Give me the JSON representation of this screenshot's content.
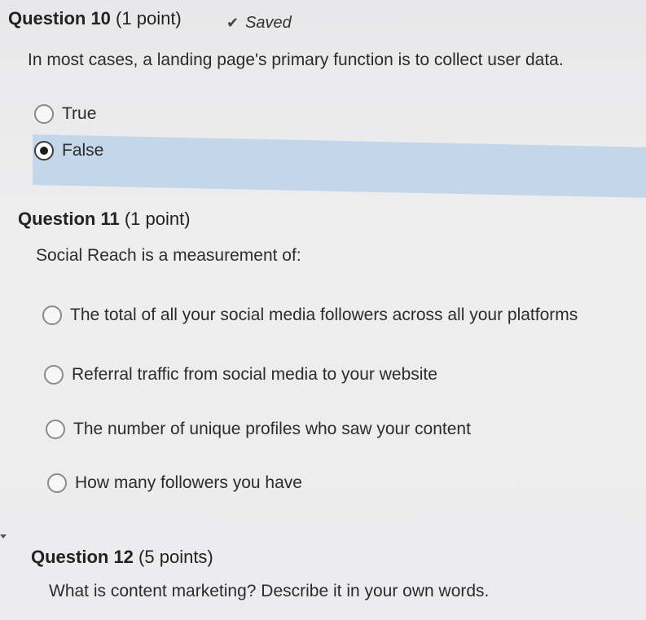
{
  "question10": {
    "title": "Question 10",
    "points": "(1 point)",
    "saved_label": "Saved",
    "check_icon": "check-icon",
    "prompt": "In most cases, a landing page's primary function is to collect user data.",
    "options": [
      {
        "label": "True",
        "selected": false
      },
      {
        "label": "False",
        "selected": true
      }
    ],
    "selected_color": "#c4d6ea"
  },
  "question11": {
    "title": "Question 11",
    "points": "(1 point)",
    "prompt": "Social Reach is a measurement of:",
    "options": [
      {
        "label": "The total of all your social media followers across all your platforms",
        "selected": false
      },
      {
        "label": "Referral traffic from social media to your website",
        "selected": false
      },
      {
        "label": "The number of unique profiles who saw your content",
        "selected": false
      },
      {
        "label": "How many followers you have",
        "selected": false
      }
    ]
  },
  "question12": {
    "title": "Question 12",
    "points": "(5 points)",
    "prompt": "What is content marketing? Describe it in your own words."
  }
}
